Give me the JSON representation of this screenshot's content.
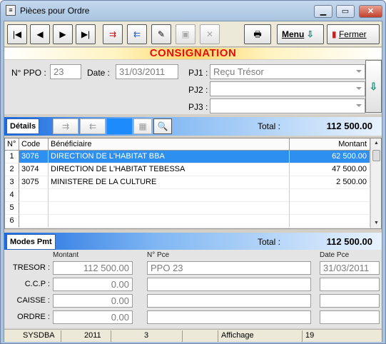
{
  "window": {
    "title": "Pièces pour Ordre",
    "app_icon": "document-icon"
  },
  "toolbar": {
    "first_icon": "⏮",
    "prev_icon": "◀",
    "next_icon": "▶",
    "last_icon": "⏭",
    "menu_label": "Menu",
    "close_label": "Fermer"
  },
  "banner": "CONSIGNATION",
  "header": {
    "nppo_label": "N° PPO :",
    "nppo_value": "23",
    "date_label": "Date :",
    "date_value": "31/03/2011",
    "pj1_label": "PJ1 :",
    "pj1_value": "Reçu Trésor",
    "pj2_label": "PJ2 :",
    "pj2_value": "",
    "pj3_label": "PJ3 :",
    "pj3_value": ""
  },
  "details": {
    "tab_label": "Détails",
    "total_label": "Total :",
    "total_value": "112 500.00",
    "columns": [
      "N°",
      "Code",
      "Bénéficiaire",
      "Montant"
    ],
    "rows": [
      {
        "num": "1",
        "code": "3076",
        "beneficiaire": "DIRECTION DE L'HABITAT BBA",
        "montant": "62 500.00"
      },
      {
        "num": "2",
        "code": "3074",
        "beneficiaire": "DIRECTION DE L'HABITAT TEBESSA",
        "montant": "47 500.00"
      },
      {
        "num": "3",
        "code": "3075",
        "beneficiaire": "MINISTERE DE LA CULTURE",
        "montant": "2 500.00"
      },
      {
        "num": "4",
        "code": "",
        "beneficiaire": "",
        "montant": ""
      },
      {
        "num": "5",
        "code": "",
        "beneficiaire": "",
        "montant": ""
      },
      {
        "num": "6",
        "code": "",
        "beneficiaire": "",
        "montant": ""
      }
    ],
    "selected_row": 0
  },
  "payments": {
    "tab_label": "Modes Pmt",
    "total_label": "Total :",
    "total_value": "112 500.00",
    "col_montant": "Montant",
    "col_npce": "N° Pce",
    "col_datepce": "Date Pce",
    "rows": [
      {
        "label": "TRESOR :",
        "montant": "112 500.00",
        "npce": "PPO 23",
        "date": "31/03/2011"
      },
      {
        "label": "C.C.P :",
        "montant": "0.00",
        "npce": "",
        "date": ""
      },
      {
        "label": "CAISSE :",
        "montant": "0.00",
        "npce": "",
        "date": ""
      },
      {
        "label": "ORDRE :",
        "montant": "0.00",
        "npce": "",
        "date": ""
      }
    ]
  },
  "status": {
    "user": "SYSDBA",
    "year": "2011",
    "count": "3",
    "blank": "",
    "mode": "Affichage",
    "number": "19"
  }
}
